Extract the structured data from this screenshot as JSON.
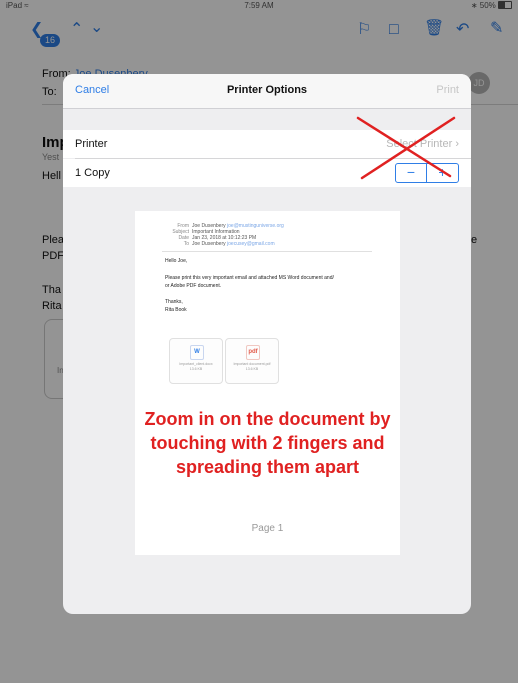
{
  "status_bar": {
    "device": "iPad",
    "time": "7:59 AM",
    "battery": "50%"
  },
  "toolbar": {
    "badge": "16",
    "icons": [
      "chevron-left-icon",
      "chevron-up-icon",
      "chevron-down-icon",
      "flag-icon",
      "folder-icon",
      "trash-icon",
      "reply-icon",
      "compose-icon"
    ]
  },
  "email": {
    "from_label": "From:",
    "from_name": "Joe Dusenbery",
    "to_label": "To:",
    "subject": "Imp",
    "date": "Yest",
    "greeting": "Hell",
    "body_line_1": "Plea",
    "body_line_2": "PDF",
    "body_suffix": "e",
    "thanks": "Tha",
    "sign": "Rita",
    "attachment_hint": "In",
    "avatar": "JD"
  },
  "print_sheet": {
    "cancel_label": "Cancel",
    "title": "Printer Options",
    "print_label": "Print",
    "printer_label": "Printer",
    "printer_value": "Select Printer",
    "copies_label": "1 Copy",
    "stepper_minus": "−",
    "stepper_plus": "+"
  },
  "preview": {
    "from_key": "From",
    "from_value": "Joe Dusenbery",
    "from_email": "joe@mustinguniverse.org",
    "subject_key": "Subject",
    "subject_value": "Important Information",
    "date_key": "Date",
    "date_value": "Jan 23, 2018 at 10:12:23 PM",
    "to_key": "To",
    "to_value": "Joe Dusenbery",
    "to_email": "joecusey@gmail.com",
    "greeting": "Hello Joe,",
    "body_1": "Please print this very important email and attached MS Word document and/",
    "body_2": "or Adobe PDF document.",
    "thanks": "Thanks,",
    "signature": "Rita Book",
    "attachment_1_icon": "W",
    "attachment_1_name": "Important_client.docx",
    "attachment_1_size": "13.6 KB",
    "attachment_2_icon": "pdf",
    "attachment_2_name": "Important document.pdf",
    "attachment_2_size": "13.6 KB",
    "instruction_line_1": "Zoom in on the document by",
    "instruction_line_2": "touching with 2 fingers and",
    "instruction_line_3": "spreading them apart",
    "page_label": "Page 1"
  },
  "colors": {
    "accent": "#2f7ee6",
    "instruction": "#e02121",
    "annotation_x": "#e02121"
  }
}
